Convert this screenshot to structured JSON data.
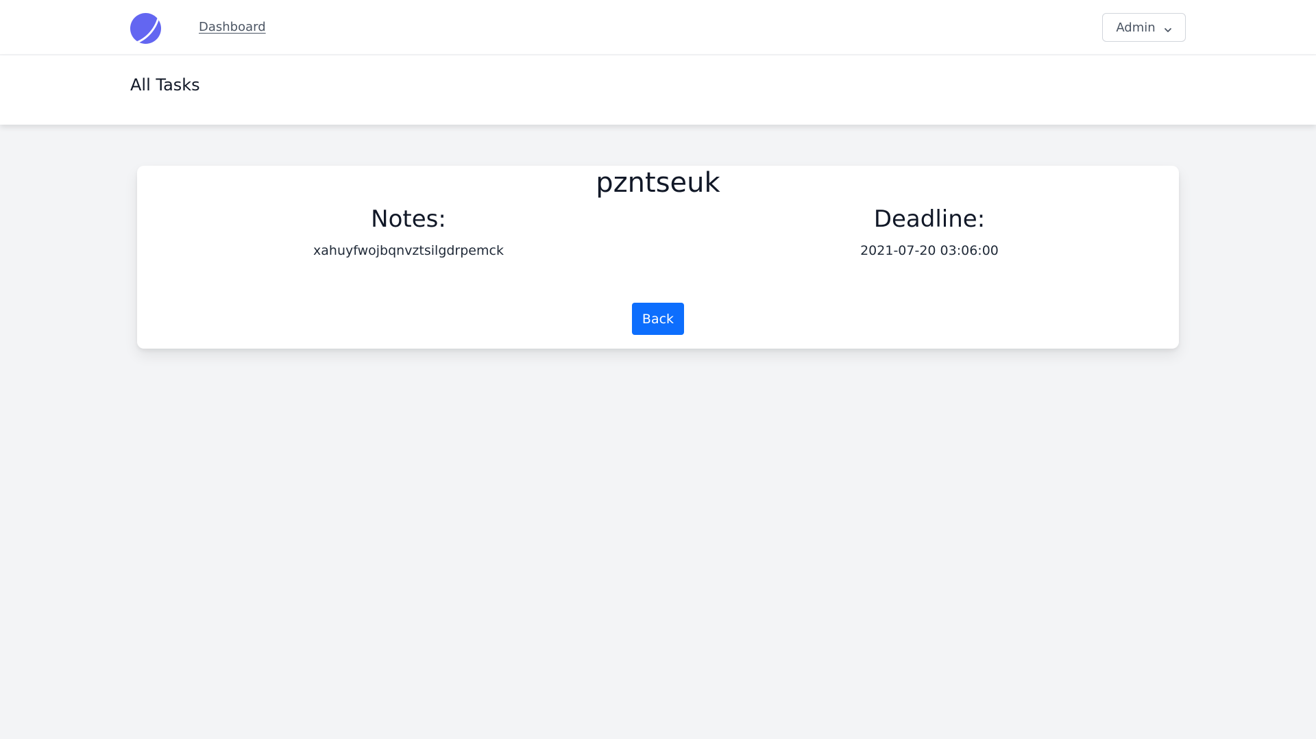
{
  "nav": {
    "logo_icon": "app-logo-icon",
    "links": [
      {
        "label": "Dashboard"
      }
    ],
    "user_menu": {
      "label": "Admin",
      "icon": "chevron-down-icon"
    }
  },
  "header": {
    "title": "All Tasks"
  },
  "task": {
    "title": "pzntseuk",
    "notes_label": "Notes:",
    "notes_value": "xahuyfwojbqnvztsilgdrpemck",
    "deadline_label": "Deadline:",
    "deadline_value": "2021-07-20 03:06:00",
    "back_label": "Back"
  },
  "colors": {
    "accent": "#0d6efd",
    "logo": "#6366f1",
    "background": "#f3f4f6"
  }
}
